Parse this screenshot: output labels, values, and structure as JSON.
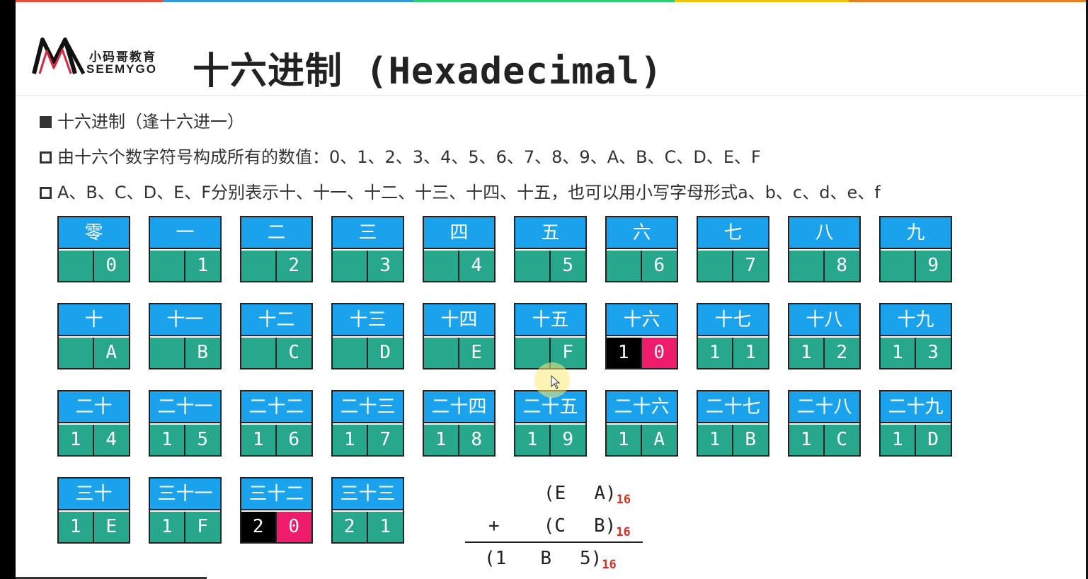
{
  "logo": {
    "cn": "小码哥教育",
    "en": "SEEMYGO"
  },
  "title": "十六进制 (Hexadecimal)",
  "bullets": [
    "十六进制（逢十六进一）",
    "由十六个数字符号构成所有的数值：0、1、2、3、4、5、6、7、8、9、A、B、C、D、E、F",
    "A、B、C、D、E、F分别表示十、十一、十二、十三、十四、十五，也可以用小写字母形式a、b、c、d、e、f"
  ],
  "table": [
    {
      "name": "零",
      "d1": "",
      "d2": "0"
    },
    {
      "name": "一",
      "d1": "",
      "d2": "1"
    },
    {
      "name": "二",
      "d1": "",
      "d2": "2"
    },
    {
      "name": "三",
      "d1": "",
      "d2": "3"
    },
    {
      "name": "四",
      "d1": "",
      "d2": "4"
    },
    {
      "name": "五",
      "d1": "",
      "d2": "5"
    },
    {
      "name": "六",
      "d1": "",
      "d2": "6"
    },
    {
      "name": "七",
      "d1": "",
      "d2": "7"
    },
    {
      "name": "八",
      "d1": "",
      "d2": "8"
    },
    {
      "name": "九",
      "d1": "",
      "d2": "9"
    },
    {
      "name": "十",
      "d1": "",
      "d2": "A"
    },
    {
      "name": "十一",
      "d1": "",
      "d2": "B"
    },
    {
      "name": "十二",
      "d1": "",
      "d2": "C"
    },
    {
      "name": "十三",
      "d1": "",
      "d2": "D"
    },
    {
      "name": "十四",
      "d1": "",
      "d2": "E"
    },
    {
      "name": "十五",
      "d1": "",
      "d2": "F"
    },
    {
      "name": "十六",
      "d1": "1",
      "d2": "0",
      "highlight": true
    },
    {
      "name": "十七",
      "d1": "1",
      "d2": "1"
    },
    {
      "name": "十八",
      "d1": "1",
      "d2": "2"
    },
    {
      "name": "十九",
      "d1": "1",
      "d2": "3"
    },
    {
      "name": "二十",
      "d1": "1",
      "d2": "4"
    },
    {
      "name": "二十一",
      "d1": "1",
      "d2": "5"
    },
    {
      "name": "二十二",
      "d1": "1",
      "d2": "6"
    },
    {
      "name": "二十三",
      "d1": "1",
      "d2": "7"
    },
    {
      "name": "二十四",
      "d1": "1",
      "d2": "8"
    },
    {
      "name": "二十五",
      "d1": "1",
      "d2": "9"
    },
    {
      "name": "二十六",
      "d1": "1",
      "d2": "A"
    },
    {
      "name": "二十七",
      "d1": "1",
      "d2": "B"
    },
    {
      "name": "二十八",
      "d1": "1",
      "d2": "C"
    },
    {
      "name": "二十九",
      "d1": "1",
      "d2": "D"
    },
    {
      "name": "三十",
      "d1": "1",
      "d2": "E"
    },
    {
      "name": "三十一",
      "d1": "1",
      "d2": "F"
    },
    {
      "name": "三十二",
      "d1": "2",
      "d2": "0",
      "highlight": true
    },
    {
      "name": "三十三",
      "d1": "2",
      "d2": "1"
    }
  ],
  "addition": {
    "row1": {
      "left": "",
      "a": "(E",
      "b": "A)",
      "base": "16"
    },
    "row2": {
      "left": "+",
      "a": "(C",
      "b": "B)",
      "base": "16"
    },
    "row3": {
      "left": "(1",
      "a": "B",
      "b": "5)",
      "base": "16"
    }
  },
  "colors": {
    "header": "#1aa3ec",
    "digits": "#27a88d",
    "carry": "#000000",
    "zero": "#ee1c6a",
    "base": "#d93025"
  }
}
